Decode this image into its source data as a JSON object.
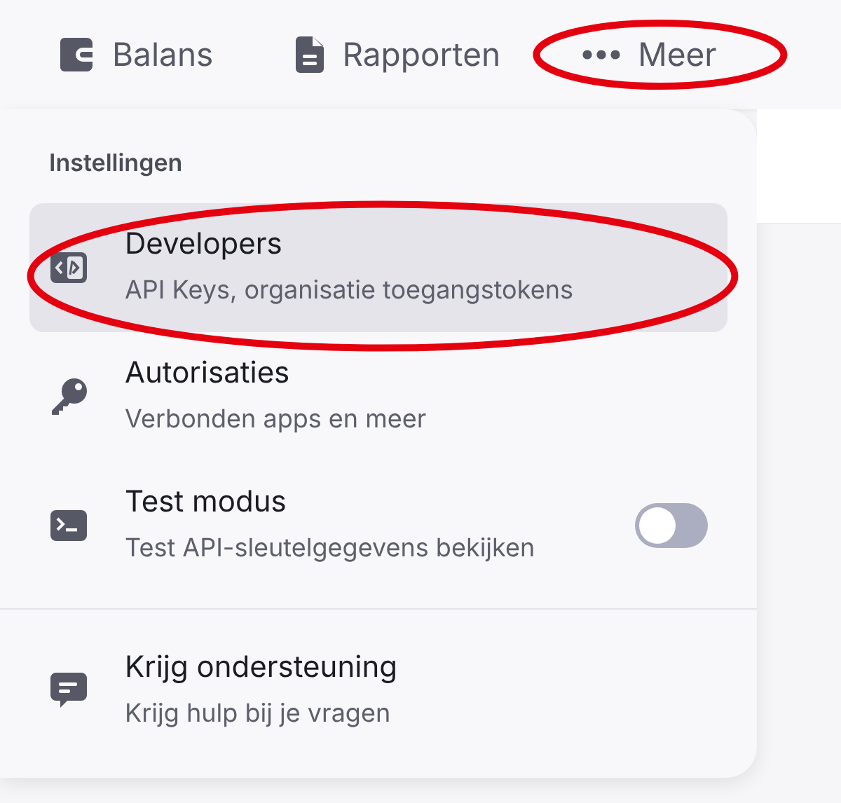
{
  "nav": [
    {
      "label": "Balans",
      "circled": false
    },
    {
      "label": "Rapporten",
      "circled": false
    },
    {
      "label": "Meer",
      "circled": true
    }
  ],
  "menu": {
    "heading": "Instellingen",
    "sections": [
      {
        "items": [
          {
            "kind": "link",
            "title": "Developers",
            "subtitle": "API Keys, organisatie toegangstokens",
            "selected": true,
            "circled": true
          },
          {
            "kind": "link",
            "title": "Autorisaties",
            "subtitle": "Verbonden apps en meer",
            "selected": false,
            "circled": false
          },
          {
            "kind": "toggle",
            "title": "Test modus",
            "subtitle": "Test API-sleutelgegevens bekijken",
            "selected": false,
            "circled": false,
            "on": false
          }
        ]
      },
      {
        "items": [
          {
            "kind": "link",
            "title": "Krijg ondersteuning",
            "subtitle": "Krijg hulp bij je vragen",
            "selected": false,
            "circled": false
          }
        ]
      }
    ]
  }
}
